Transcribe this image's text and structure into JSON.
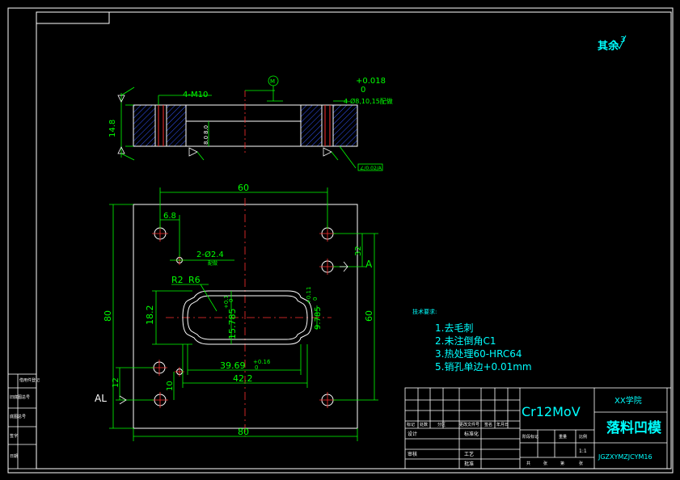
{
  "title_block": {
    "remaining_mark": "其余",
    "remaining_value": "3",
    "material": "Cr12MoV",
    "school": "XX学院",
    "part_name": "落料凹模",
    "drawing_no": "JGZXYMZJCYM16",
    "scale": "1:1",
    "row_labels": [
      "标记",
      "处数",
      "分区",
      "更改文件号",
      "签名",
      "年月日"
    ],
    "sign_labels": [
      "设计",
      "标准化",
      "审核",
      "工艺",
      "批准"
    ],
    "stage_labels": [
      "阶段标记",
      "重量",
      "比例"
    ],
    "sheet_labels": [
      "共",
      "张",
      "第",
      "张"
    ]
  },
  "tech_req": {
    "title": "技术要求:",
    "items": [
      "1.去毛刺",
      "2.未注倒角C1",
      "3.热处理60-HRC64",
      "5.销孔单边+0.01mm"
    ]
  },
  "side_view": {
    "thread": "4-M10",
    "dim_height": "14.8",
    "dim_8a": "8.0",
    "dim_8b": "8.0",
    "tol_upper": "+0.018",
    "tol_lower": "0",
    "tol_note": "4-Ø8,10,15配做",
    "circle_mark": "M",
    "callout": "∠/0.02/A"
  },
  "plan_view": {
    "dim_top": "60",
    "dim_68": "6.8",
    "pin_holes": "2-Ø2.4",
    "pin_note": "配做",
    "dim_32": "32",
    "datum_a": "A",
    "r2": "R2",
    "r6": "R6",
    "dim_182": "18.2",
    "dim_15785": "15.785",
    "tol_upper_a": "+0.1",
    "tol_lower_a": "0",
    "dim_9785": "9.785",
    "tol_upper_b": "+0.11",
    "tol_lower_b": "0",
    "dim_3969": "39.69",
    "tol_upper_c": "+0.16",
    "tol_lower_c": "0",
    "dim_422": "42.2",
    "dim_12": "12",
    "dim_10": "10",
    "dim_80_left": "80",
    "dim_60_right": "60",
    "dim_80_bottom": "80",
    "datum_al": "AL"
  },
  "left_strip": {
    "labels": [
      "借用件登记",
      "旧底图总号",
      "底图总号",
      "签字",
      "日期"
    ]
  }
}
